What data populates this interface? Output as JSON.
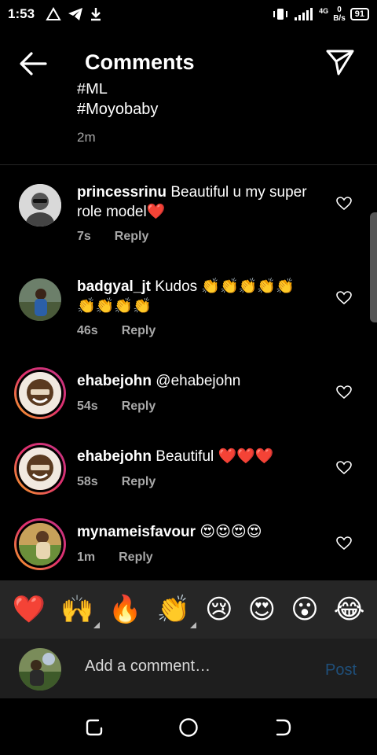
{
  "status": {
    "time": "1:53",
    "icons": [
      "warning-triangle-icon",
      "telegram-icon",
      "download-icon"
    ],
    "network": "4G",
    "speed_value": "0",
    "speed_unit": "B/s",
    "battery": "91"
  },
  "header": {
    "title": "Comments",
    "back_icon": "arrow-left-icon",
    "share_icon": "send-icon"
  },
  "caption": {
    "tag_partial": "#ML",
    "tag": "#Moyobaby",
    "time": "2m"
  },
  "comments": [
    {
      "username": "princessrinu",
      "text": "Beautiful u my super role model❤️",
      "time": "7s",
      "reply": "Reply",
      "ring": false
    },
    {
      "username": "badgyal_jt",
      "text": "Kudos 👏👏👏👏👏👏👏👏👏",
      "time": "46s",
      "reply": "Reply",
      "ring": false
    },
    {
      "username": "ehabejohn",
      "text": "@ehabejohn",
      "time": "54s",
      "reply": "Reply",
      "ring": true
    },
    {
      "username": "ehabejohn",
      "text": "Beautiful ❤️❤️❤️",
      "time": "58s",
      "reply": "Reply",
      "ring": true
    },
    {
      "username": "mynameisfavour",
      "text": "😍😍😍😍",
      "time": "1m",
      "reply": "Reply",
      "ring": true
    }
  ],
  "emoji_bar": [
    "❤️",
    "🙌",
    "🔥",
    "👏",
    "😢",
    "😍",
    "😮",
    "😂"
  ],
  "add_comment": {
    "placeholder": "Add a comment…",
    "post_label": "Post"
  },
  "colors": {
    "background": "#000000",
    "secondary_text": "#a8a8a8",
    "post_disabled": "#1f4f7a",
    "story_ring_start": "#f5a623",
    "story_ring_end": "#c13584"
  }
}
